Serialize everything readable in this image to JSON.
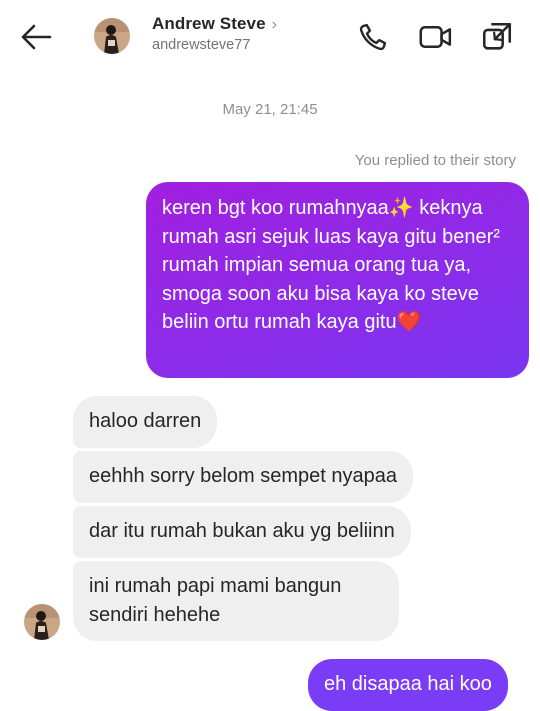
{
  "header": {
    "name": "Andrew Steve",
    "chevron": "›",
    "handle": "andrewsteve77",
    "icons": [
      "back-arrow-icon",
      "phone-icon",
      "video-icon",
      "external-link-icon"
    ]
  },
  "thread": {
    "timestamp": "May 21, 21:45",
    "reply_note": "You replied to their story",
    "messages": [
      {
        "sender": "me",
        "text": "keren bgt koo rumahnyaa✨ keknya rumah asri sejuk luas kaya gitu bener² rumah impian semua orang tua ya, smoga soon aku bisa kaya ko steve beliin ortu rumah kaya gitu❤️"
      },
      {
        "sender": "them",
        "text": "haloo darren"
      },
      {
        "sender": "them",
        "text": "eehhh sorry belom sempet nyapaa"
      },
      {
        "sender": "them",
        "text": "dar itu rumah bukan aku yg beliinn"
      },
      {
        "sender": "them",
        "text": "ini rumah papi mami bangun sendiri hehehe"
      },
      {
        "sender": "me",
        "text": "eh disapaa hai koo"
      }
    ]
  },
  "colors": {
    "outgoing_gradient_start": "#a21fe0",
    "outgoing_gradient_end": "#7a36f0",
    "incoming_bg": "#efefef",
    "meta_text": "#8e8e8e"
  }
}
